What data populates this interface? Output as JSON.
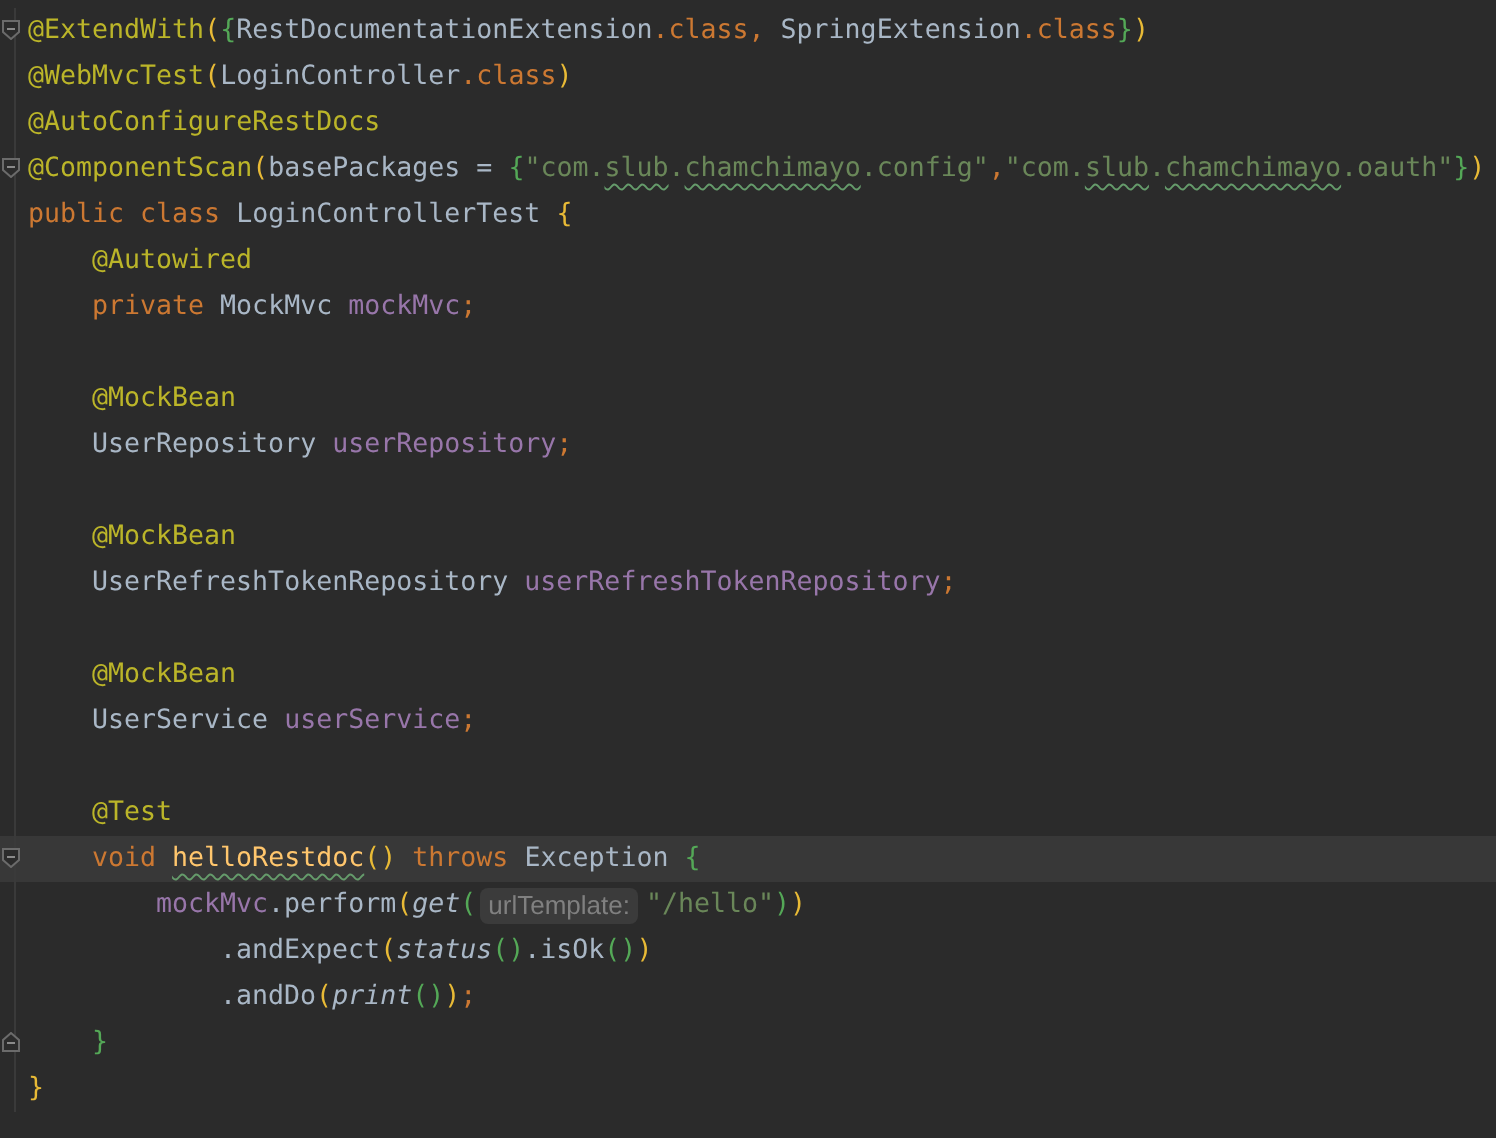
{
  "editor": {
    "lines": [
      {
        "fold_start": true,
        "fold_end": false,
        "current": false,
        "tokens": [
          {
            "text": "@ExtendWith",
            "kind": "annotation"
          },
          {
            "text": "(",
            "kind": "p1"
          },
          {
            "text": "{",
            "kind": "p2"
          },
          {
            "text": "RestDocumentationExtension",
            "kind": "plain"
          },
          {
            "text": ".class, ",
            "kind": "keyword"
          },
          {
            "text": "SpringExtension",
            "kind": "plain"
          },
          {
            "text": ".class",
            "kind": "keyword"
          },
          {
            "text": "}",
            "kind": "p2"
          },
          {
            "text": ")",
            "kind": "p1"
          }
        ]
      },
      {
        "fold_start": false,
        "fold_end": false,
        "current": false,
        "tokens": [
          {
            "text": "@WebMvcTest",
            "kind": "annotation"
          },
          {
            "text": "(",
            "kind": "p1"
          },
          {
            "text": "LoginController",
            "kind": "plain"
          },
          {
            "text": ".class",
            "kind": "keyword"
          },
          {
            "text": ")",
            "kind": "p1"
          }
        ]
      },
      {
        "fold_start": false,
        "fold_end": false,
        "current": false,
        "tokens": [
          {
            "text": "@AutoConfigureRestDocs",
            "kind": "annotation"
          }
        ]
      },
      {
        "fold_start": true,
        "fold_end": false,
        "current": false,
        "tokens": [
          {
            "text": "@ComponentScan",
            "kind": "annotation"
          },
          {
            "text": "(",
            "kind": "p1"
          },
          {
            "text": "basePackages = ",
            "kind": "plain"
          },
          {
            "text": "{",
            "kind": "p2"
          },
          {
            "text": "\"com.",
            "kind": "string"
          },
          {
            "text": "slub",
            "kind": "string-typo"
          },
          {
            "text": ".",
            "kind": "string"
          },
          {
            "text": "chamchimayo",
            "kind": "string-typo"
          },
          {
            "text": ".config\"",
            "kind": "string"
          },
          {
            "text": ",",
            "kind": "keyword"
          },
          {
            "text": "\"com.",
            "kind": "string"
          },
          {
            "text": "slub",
            "kind": "string-typo"
          },
          {
            "text": ".",
            "kind": "string"
          },
          {
            "text": "chamchimayo",
            "kind": "string-typo"
          },
          {
            "text": ".oauth\"",
            "kind": "string"
          },
          {
            "text": "}",
            "kind": "p2"
          },
          {
            "text": ")",
            "kind": "p1"
          }
        ]
      },
      {
        "fold_start": false,
        "fold_end": false,
        "current": false,
        "tokens": [
          {
            "text": "public class ",
            "kind": "keyword"
          },
          {
            "text": "LoginControllerTest ",
            "kind": "plain"
          },
          {
            "text": "{",
            "kind": "p1"
          }
        ],
        "children": [
          {
            "fold_start": false,
            "fold_end": false,
            "current": false,
            "tokens": [
              {
                "text": "@Autowired",
                "kind": "annotation"
              }
            ]
          },
          {
            "fold_start": false,
            "fold_end": false,
            "current": false,
            "tokens": [
              {
                "text": "private ",
                "kind": "keyword"
              },
              {
                "text": "MockMvc ",
                "kind": "plain"
              },
              {
                "text": "mockMvc",
                "kind": "field"
              },
              {
                "text": ";",
                "kind": "keyword"
              }
            ]
          },
          {
            "fold_start": false,
            "fold_end": false,
            "current": false
          },
          {
            "fold_start": false,
            "fold_end": false,
            "current": false,
            "tokens": [
              {
                "text": "@MockBean",
                "kind": "annotation"
              }
            ]
          },
          {
            "fold_start": false,
            "fold_end": false,
            "current": false,
            "tokens": [
              {
                "text": "UserRepository ",
                "kind": "plain"
              },
              {
                "text": "userRepository",
                "kind": "field"
              },
              {
                "text": ";",
                "kind": "keyword"
              }
            ]
          },
          {
            "fold_start": false,
            "fold_end": false,
            "current": false
          },
          {
            "fold_start": false,
            "fold_end": false,
            "current": false,
            "tokens": [
              {
                "text": "@MockBean",
                "kind": "annotation"
              }
            ]
          },
          {
            "fold_start": false,
            "fold_end": false,
            "current": false,
            "tokens": [
              {
                "text": "UserRefreshTokenRepository ",
                "kind": "plain"
              },
              {
                "text": "userRefreshTokenRepository",
                "kind": "field"
              },
              {
                "text": ";",
                "kind": "keyword"
              }
            ]
          },
          {
            "fold_start": false,
            "fold_end": false,
            "current": false
          },
          {
            "fold_start": false,
            "fold_end": false,
            "current": false,
            "tokens": [
              {
                "text": "@MockBean",
                "kind": "annotation"
              }
            ]
          },
          {
            "fold_start": false,
            "fold_end": false,
            "current": false,
            "tokens": [
              {
                "text": "UserService ",
                "kind": "plain"
              },
              {
                "text": "userService",
                "kind": "field"
              },
              {
                "text": ";",
                "kind": "keyword"
              }
            ]
          },
          {
            "fold_start": false,
            "fold_end": false,
            "current": false
          },
          {
            "fold_start": false,
            "fold_end": false,
            "current": false,
            "tokens": [
              {
                "text": "@Test",
                "kind": "annotation"
              }
            ]
          },
          {
            "fold_start": true,
            "fold_end": false,
            "current": true,
            "tokens": [
              {
                "text": "void ",
                "kind": "keyword"
              },
              {
                "text": "helloRestdoc",
                "kind": "method-typo"
              },
              {
                "text": "() ",
                "kind": "p1"
              },
              {
                "text": "throws ",
                "kind": "keyword"
              },
              {
                "text": "Exception ",
                "kind": "plain"
              },
              {
                "text": "{",
                "kind": "p2"
              }
            ],
            "children": [
              {
                "fold_start": false,
                "fold_end": false,
                "current": false,
                "tokens": [
                  {
                    "text": "mockMvc",
                    "kind": "field"
                  },
                  {
                    "text": ".perform",
                    "kind": "plain"
                  },
                  {
                    "text": "(",
                    "kind": "p1"
                  },
                  {
                    "text": "get",
                    "kind": "static"
                  },
                  {
                    "text": "(",
                    "kind": "p2"
                  },
                  {
                    "text": "urlTemplate:",
                    "kind": "hint"
                  },
                  {
                    "text": "\"/hello\"",
                    "kind": "string"
                  },
                  {
                    "text": ")",
                    "kind": "p2"
                  },
                  {
                    "text": ")",
                    "kind": "p1"
                  }
                ],
                "children": [
                  {
                    "fold_start": false,
                    "fold_end": false,
                    "current": false,
                    "tokens": [
                      {
                        "text": ".andExpect",
                        "kind": "plain"
                      },
                      {
                        "text": "(",
                        "kind": "p1"
                      },
                      {
                        "text": "status",
                        "kind": "static"
                      },
                      {
                        "text": "()",
                        "kind": "p2"
                      },
                      {
                        "text": ".isOk",
                        "kind": "plain"
                      },
                      {
                        "text": "()",
                        "kind": "p2"
                      },
                      {
                        "text": ")",
                        "kind": "p1"
                      }
                    ]
                  },
                  {
                    "fold_start": false,
                    "fold_end": false,
                    "current": false,
                    "tokens": [
                      {
                        "text": ".andDo",
                        "kind": "plain"
                      },
                      {
                        "text": "(",
                        "kind": "p1"
                      },
                      {
                        "text": "print",
                        "kind": "static"
                      },
                      {
                        "text": "()",
                        "kind": "p2"
                      },
                      {
                        "text": ")",
                        "kind": "p1"
                      },
                      {
                        "text": ";",
                        "kind": "keyword"
                      }
                    ]
                  }
                ]
              }
            ]
          },
          {
            "fold_start": false,
            "fold_end": true,
            "current": false,
            "tokens": [
              {
                "text": "}",
                "kind": "p2"
              }
            ]
          }
        ]
      },
      {
        "fold_start": false,
        "fold_end": false,
        "current": false,
        "tokens": [
          {
            "text": "}",
            "kind": "p1"
          }
        ]
      }
    ]
  }
}
